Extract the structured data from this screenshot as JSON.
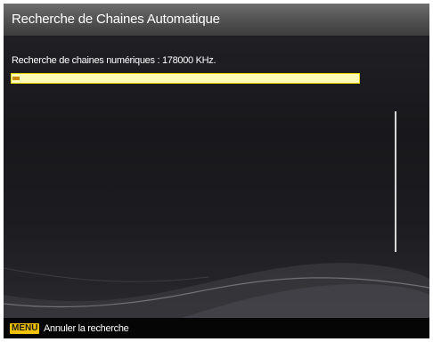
{
  "window": {
    "title": "Recherche de Chaines Automatique"
  },
  "scan": {
    "status_text": "Recherche de chaines numériques : 178000 KHz.",
    "progress_fraction": 0.02
  },
  "footer": {
    "menu_key_label": "MENU",
    "hint": "Annuler la recherche"
  },
  "colors": {
    "progress_track": "#fffbb7",
    "progress_fill": "#c88a00",
    "menu_key": "#f2c200",
    "title_bar": "#555555",
    "background": "#18181b"
  }
}
